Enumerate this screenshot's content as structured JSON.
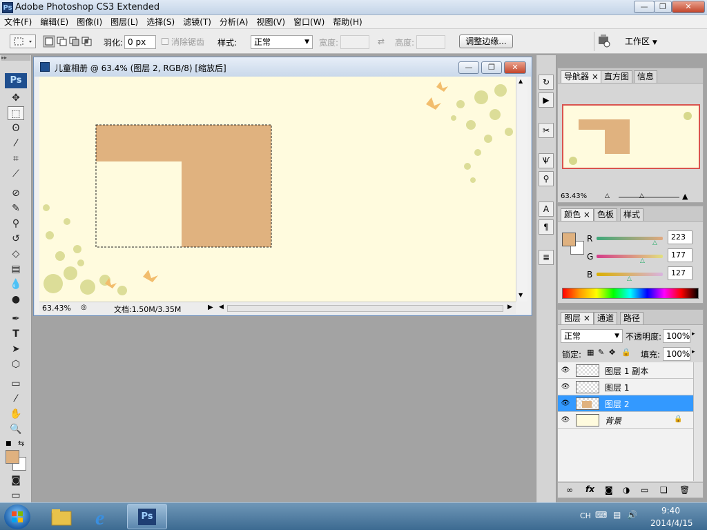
{
  "window": {
    "app_icon": "Ps",
    "title": "Adobe Photoshop CS3 Extended",
    "min": "—",
    "max": "❐",
    "close": "✕"
  },
  "menu": [
    "文件(F)",
    "编辑(E)",
    "图像(I)",
    "图层(L)",
    "选择(S)",
    "滤镜(T)",
    "分析(A)",
    "视图(V)",
    "窗口(W)",
    "帮助(H)"
  ],
  "options": {
    "feather_label": "羽化:",
    "feather_value": "0 px",
    "antialias_label": "消除锯齿",
    "style_label": "样式:",
    "style_value": "正常",
    "width_label": "宽度:",
    "height_label": "高度:",
    "refine_button": "调整边缘...",
    "workspace_label": "工作区"
  },
  "toolbox": {
    "logo": "Ps"
  },
  "document": {
    "title": "儿童相册 @ 63.4% (图层 2, RGB/8) [缩放后]",
    "zoom": "63.43%",
    "doc_info": "文档:1.50M/3.35M",
    "shape_color": "#e0b27f",
    "bg_color": "#fffbde"
  },
  "navigator": {
    "tabs": [
      "导航器",
      "直方图",
      "信息"
    ],
    "zoom": "63.43%"
  },
  "color_panel": {
    "tabs": [
      "颜色",
      "色板",
      "样式"
    ],
    "r_label": "R",
    "g_label": "G",
    "b_label": "B",
    "r": "223",
    "g": "177",
    "b": "127",
    "fg_color": "#dfb17f"
  },
  "layers_panel": {
    "tabs": [
      "图层",
      "通道",
      "路径"
    ],
    "blend_mode": "正常",
    "opacity_label": "不透明度:",
    "opacity": "100%",
    "lock_label": "锁定:",
    "fill_label": "填充:",
    "fill": "100%",
    "layers": [
      {
        "name": "图层 1 副本"
      },
      {
        "name": "图层 1"
      },
      {
        "name": "图层 2"
      },
      {
        "name": "背景"
      }
    ]
  },
  "taskbar": {
    "lang": "CH",
    "time": "9:40",
    "date": "2014/4/15",
    "ps_label": "Ps"
  }
}
